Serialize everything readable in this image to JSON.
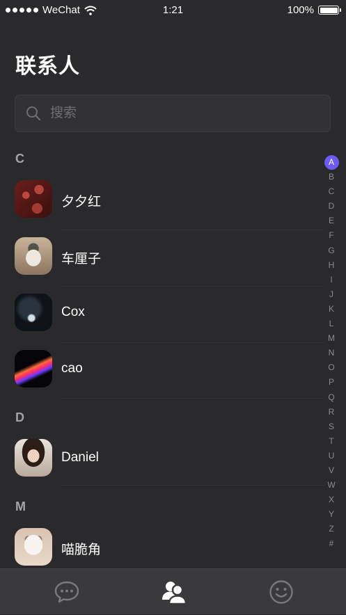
{
  "status_bar": {
    "carrier": "WeChat",
    "time": "1:21",
    "battery": "100%"
  },
  "page": {
    "title": "联系人"
  },
  "search": {
    "placeholder": "搜索"
  },
  "sections": [
    {
      "letter": "C"
    },
    {
      "letter": "D"
    },
    {
      "letter": "M"
    }
  ],
  "contacts": [
    {
      "name": "夕夕红",
      "section": "C"
    },
    {
      "name": "车厘子",
      "section": "C"
    },
    {
      "name": "Cox",
      "section": "C"
    },
    {
      "name": "cao",
      "section": "C"
    },
    {
      "name": "Daniel",
      "section": "D"
    },
    {
      "name": "喵脆角",
      "section": "M"
    }
  ],
  "index_bar": {
    "letters": [
      "A",
      "B",
      "C",
      "D",
      "E",
      "F",
      "G",
      "H",
      "I",
      "J",
      "K",
      "L",
      "M",
      "N",
      "O",
      "P",
      "Q",
      "R",
      "S",
      "T",
      "U",
      "V",
      "W",
      "X",
      "Y",
      "Z",
      "#"
    ],
    "active": "A"
  },
  "tab_bar": {
    "tabs": [
      {
        "icon": "chat-bubble-icon",
        "active": false
      },
      {
        "icon": "contacts-icon",
        "active": true
      },
      {
        "icon": "smiley-icon",
        "active": false
      }
    ]
  },
  "colors": {
    "background": "#2a2a2c",
    "accent": "#6a5cf0",
    "tab_bar": "#3a3a3c",
    "section_header": "#a3a3a7"
  }
}
